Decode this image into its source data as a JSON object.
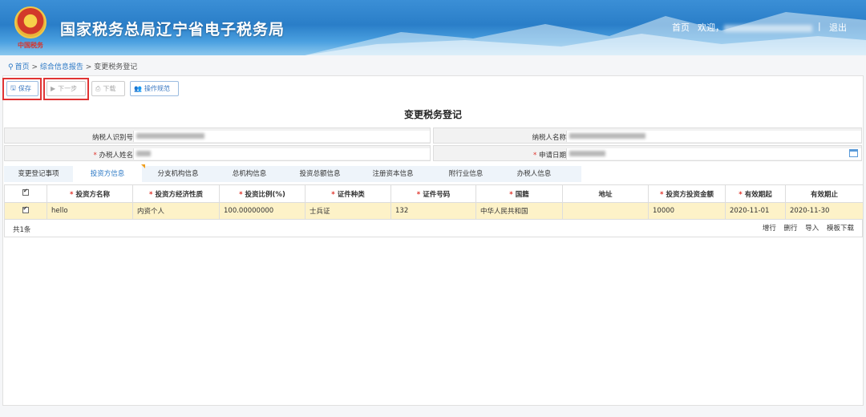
{
  "header": {
    "title": "国家税务总局辽宁省电子税务局",
    "emblem_caption": "中国税务",
    "home": "首页",
    "welcome": "欢迎，",
    "separator": "|",
    "logout": "退出"
  },
  "breadcrumb": {
    "home": "首页",
    "sep1": ">",
    "level1": "综合信息报告",
    "sep2": ">",
    "current": "变更税务登记"
  },
  "toolbar": {
    "save": "保存",
    "next": "下一步",
    "download": "下载",
    "guide": "操作规范"
  },
  "page_title": "变更税务登记",
  "info": {
    "taxpayer_id_label": "纳税人识别号",
    "taxpayer_name_label": "纳税人名称",
    "handler_name_label": "办税人姓名",
    "apply_date_label": "申请日期",
    "required_mark": "*"
  },
  "tabs": [
    "变更登记事项",
    "投资方信息",
    "分支机构信息",
    "总机构信息",
    "投资总额信息",
    "注册资本信息",
    "附行业信息",
    "办税人信息"
  ],
  "table": {
    "headers": [
      {
        "text": "投资方名称",
        "required": true
      },
      {
        "text": "投资方经济性质",
        "required": true
      },
      {
        "text": "投资比例(%)",
        "required": true
      },
      {
        "text": "证件种类",
        "required": true
      },
      {
        "text": "证件号码",
        "required": true
      },
      {
        "text": "国籍",
        "required": true
      },
      {
        "text": "地址",
        "required": false
      },
      {
        "text": "投资方投资金额",
        "required": true
      },
      {
        "text": "有效期起",
        "required": true
      },
      {
        "text": "有效期止",
        "required": false
      }
    ],
    "rows": [
      [
        "hello",
        "内资个人",
        "100.00000000",
        "士兵证",
        "132",
        "中华人民共和国",
        "",
        "10000",
        "2020-11-01",
        "2020-11-30"
      ]
    ],
    "count": "共1条",
    "actions": [
      "增行",
      "删行",
      "导入",
      "模板下载"
    ]
  }
}
